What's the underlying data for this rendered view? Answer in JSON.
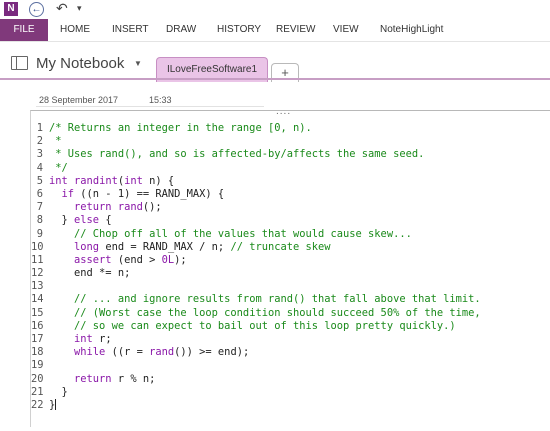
{
  "titlebar": {
    "app_icon": "onenote-icon",
    "app_icon_label": "N",
    "back": "back-icon",
    "undo": "undo-icon",
    "more": "quick-access-more-icon"
  },
  "ribbon": {
    "tabs": [
      "FILE",
      "HOME",
      "INSERT",
      "DRAW",
      "HISTORY",
      "REVIEW",
      "VIEW",
      "NoteHighLight"
    ],
    "active": "FILE",
    "accent": "#80397b"
  },
  "notebook": {
    "name": "My Notebook",
    "section": "ILoveFreeSoftware1",
    "section_color": "#eac4e7",
    "add_label": "+"
  },
  "page": {
    "date": "28 September 2017",
    "time": "15:33",
    "grip": "....",
    "code_lines": [
      [
        {
          "c": "cm",
          "t": "/* Returns an integer in the range [0, n)."
        }
      ],
      [
        {
          "c": "cm",
          "t": " *"
        }
      ],
      [
        {
          "c": "cm",
          "t": " * Uses rand(), and so is affected-by/affects the same seed."
        }
      ],
      [
        {
          "c": "cm",
          "t": " */"
        }
      ],
      [
        {
          "c": "kw",
          "t": "int"
        },
        {
          "c": "tx",
          "t": " "
        },
        {
          "c": "fn",
          "t": "randint"
        },
        {
          "c": "tx",
          "t": "("
        },
        {
          "c": "kw",
          "t": "int"
        },
        {
          "c": "tx",
          "t": " n) {"
        }
      ],
      [
        {
          "c": "tx",
          "t": "  "
        },
        {
          "c": "kw",
          "t": "if"
        },
        {
          "c": "tx",
          "t": " ((n - 1) == RAND_MAX) {"
        }
      ],
      [
        {
          "c": "tx",
          "t": "    "
        },
        {
          "c": "kw",
          "t": "return"
        },
        {
          "c": "tx",
          "t": " "
        },
        {
          "c": "fn",
          "t": "rand"
        },
        {
          "c": "tx",
          "t": "();"
        }
      ],
      [
        {
          "c": "tx",
          "t": "  } "
        },
        {
          "c": "kw",
          "t": "else"
        },
        {
          "c": "tx",
          "t": " {"
        }
      ],
      [
        {
          "c": "tx",
          "t": "    "
        },
        {
          "c": "cm",
          "t": "// Chop off all of the values that would cause skew..."
        }
      ],
      [
        {
          "c": "tx",
          "t": "    "
        },
        {
          "c": "kw",
          "t": "long"
        },
        {
          "c": "tx",
          "t": " end = RAND_MAX / n; "
        },
        {
          "c": "cm",
          "t": "// truncate skew"
        }
      ],
      [
        {
          "c": "tx",
          "t": "    "
        },
        {
          "c": "fn",
          "t": "assert"
        },
        {
          "c": "tx",
          "t": " (end > "
        },
        {
          "c": "fn",
          "t": "0L"
        },
        {
          "c": "tx",
          "t": ");"
        }
      ],
      [
        {
          "c": "tx",
          "t": "    end *= n;"
        }
      ],
      [
        {
          "c": "tx",
          "t": ""
        }
      ],
      [
        {
          "c": "tx",
          "t": "    "
        },
        {
          "c": "cm",
          "t": "// ... and ignore results from rand() that fall above that limit."
        }
      ],
      [
        {
          "c": "tx",
          "t": "    "
        },
        {
          "c": "cm",
          "t": "// (Worst case the loop condition should succeed 50% of the time,"
        }
      ],
      [
        {
          "c": "tx",
          "t": "    "
        },
        {
          "c": "cm",
          "t": "// so we can expect to bail out of this loop pretty quickly.)"
        }
      ],
      [
        {
          "c": "tx",
          "t": "    "
        },
        {
          "c": "kw",
          "t": "int"
        },
        {
          "c": "tx",
          "t": " r;"
        }
      ],
      [
        {
          "c": "tx",
          "t": "    "
        },
        {
          "c": "kw",
          "t": "while"
        },
        {
          "c": "tx",
          "t": " ((r = "
        },
        {
          "c": "fn",
          "t": "rand"
        },
        {
          "c": "tx",
          "t": "()) >= end);"
        }
      ],
      [
        {
          "c": "tx",
          "t": ""
        }
      ],
      [
        {
          "c": "tx",
          "t": "    "
        },
        {
          "c": "kw",
          "t": "return"
        },
        {
          "c": "tx",
          "t": " r % n;"
        }
      ],
      [
        {
          "c": "tx",
          "t": "  }"
        }
      ],
      [
        {
          "c": "tx",
          "t": "}"
        }
      ]
    ]
  },
  "colors": {
    "comment": "#1a8a1a",
    "keyword": "#8a17a8",
    "text": "#222222"
  }
}
